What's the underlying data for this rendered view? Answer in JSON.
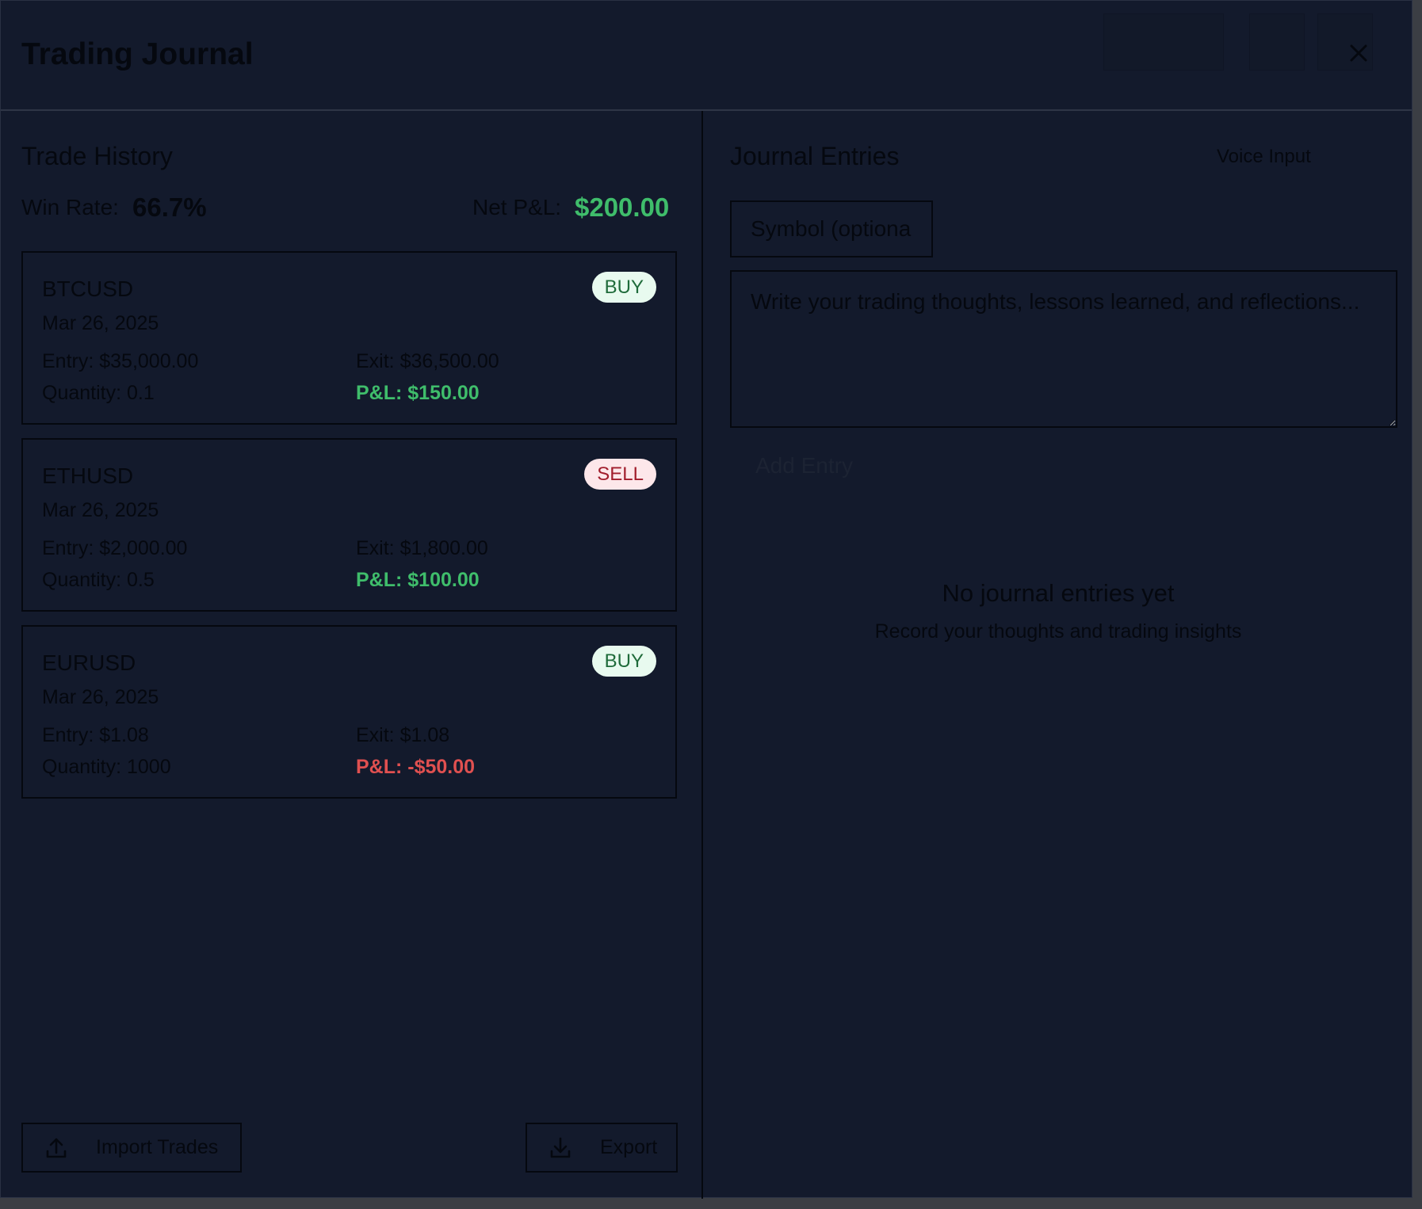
{
  "header": {
    "title": "Trading Journal",
    "close_icon": "close-icon"
  },
  "trade_history": {
    "title": "Trade History",
    "win_rate_label": "Win Rate:",
    "win_rate_value": "66.7%",
    "net_pnl_label": "Net P&L:",
    "net_pnl_value": "$200.00",
    "trades": [
      {
        "symbol": "BTCUSD",
        "side": "BUY",
        "date": "Mar 26, 2025",
        "entry": "Entry: $35,000.00",
        "exit": "Exit: $36,500.00",
        "quantity": "Quantity: 0.1",
        "pnl": "P&L: $150.00",
        "pnl_sign": "positive"
      },
      {
        "symbol": "ETHUSD",
        "side": "SELL",
        "date": "Mar 26, 2025",
        "entry": "Entry: $2,000.00",
        "exit": "Exit: $1,800.00",
        "quantity": "Quantity: 0.5",
        "pnl": "P&L: $100.00",
        "pnl_sign": "positive"
      },
      {
        "symbol": "EURUSD",
        "side": "BUY",
        "date": "Mar 26, 2025",
        "entry": "Entry: $1.08",
        "exit": "Exit: $1.08",
        "quantity": "Quantity: 1000",
        "pnl": "P&L: -$50.00",
        "pnl_sign": "negative"
      }
    ],
    "import_label": "Import Trades",
    "export_label": "Export"
  },
  "journal": {
    "title": "Journal Entries",
    "voice_input_label": "Voice Input",
    "symbol_placeholder": "Symbol (optional)",
    "thoughts_placeholder": "Write your trading thoughts, lessons learned, and reflections...",
    "add_entry_label": "Add Entry",
    "empty_title": "No journal entries yet",
    "empty_subtitle": "Record your thoughts and trading insights"
  },
  "colors": {
    "background": "#131a2c",
    "positive": "#3fbd6b",
    "negative": "#e05050",
    "buy_badge_bg": "#e8faef",
    "sell_badge_bg": "#fde7ea"
  }
}
